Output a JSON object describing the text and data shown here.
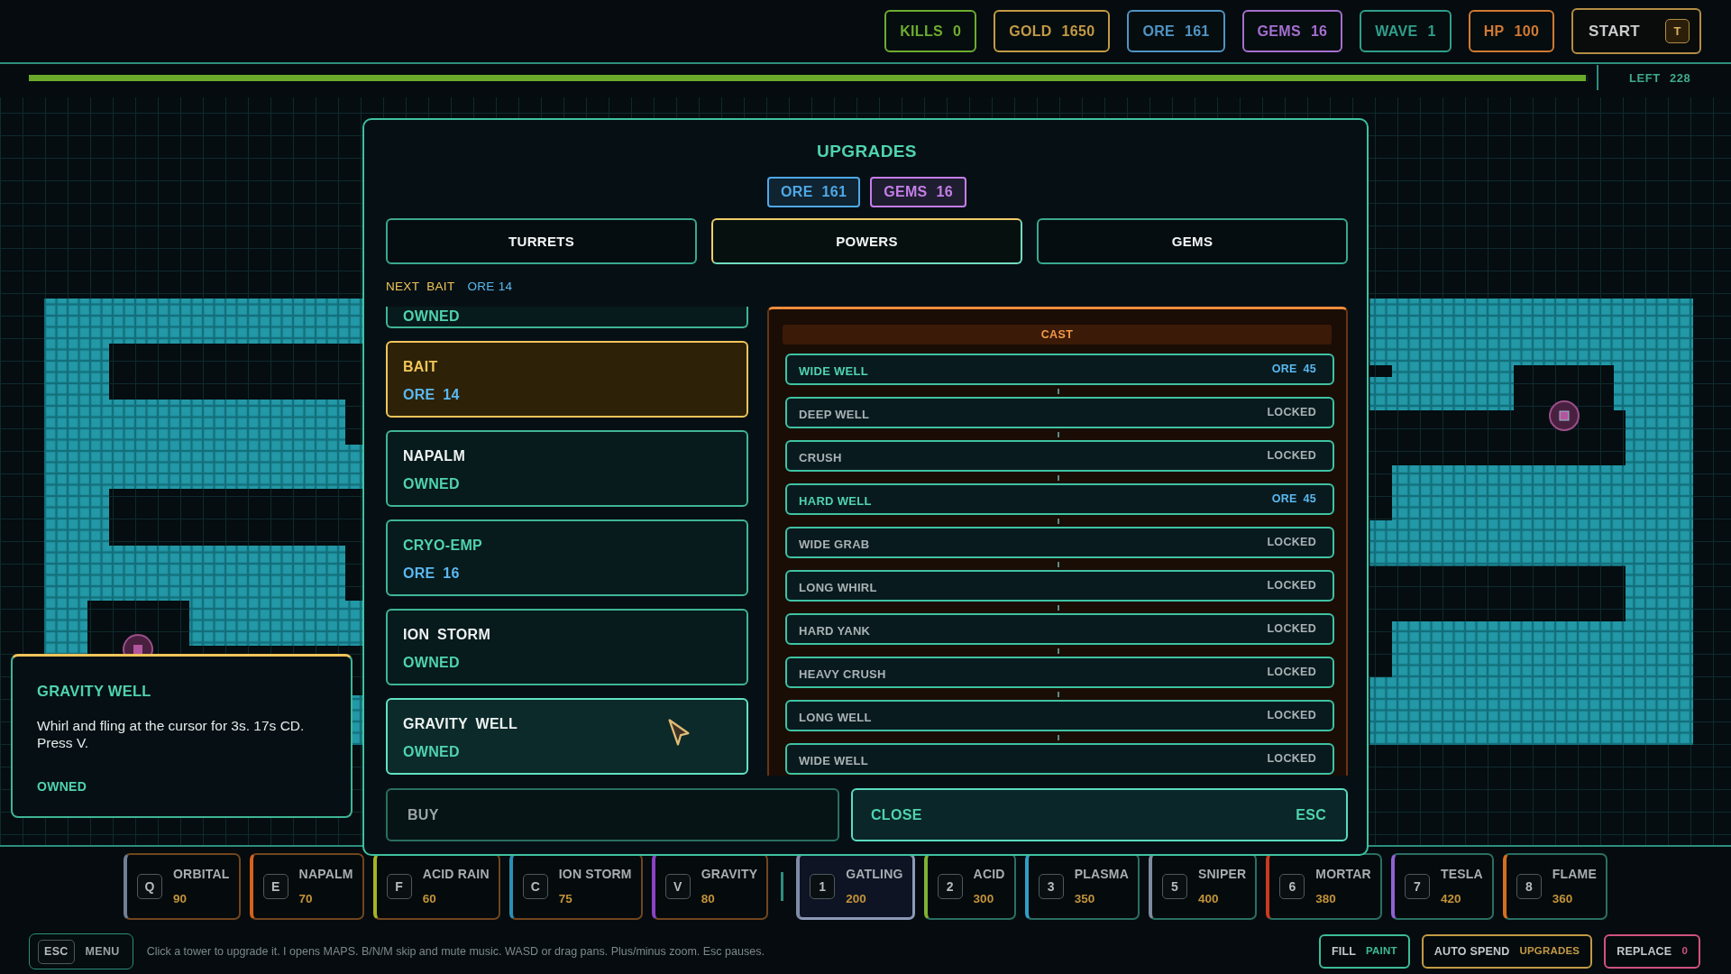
{
  "stats": [
    {
      "label": "KILLS",
      "value": "0",
      "color": "#6cad2f"
    },
    {
      "label": "GOLD",
      "value": "1650",
      "color": "#c39a45"
    },
    {
      "label": "ORE",
      "value": "161",
      "color": "#4f94c4"
    },
    {
      "label": "GEMS",
      "value": "16",
      "color": "#a46fd0"
    },
    {
      "label": "WAVE",
      "value": "1",
      "color": "#2f9f8c"
    },
    {
      "label": "HP",
      "value": "100",
      "color": "#d07a34"
    }
  ],
  "start_button": {
    "label": "START",
    "key": "T"
  },
  "wave_progress": {
    "level": 0.998,
    "label": "LEFT",
    "value": "228"
  },
  "upgrades": {
    "title": "UPGRADES",
    "currencies": [
      {
        "label": "ORE",
        "value": "161",
        "color": "#4fa8e6"
      },
      {
        "label": "GEMS",
        "value": "16",
        "color": "#c47ee8"
      }
    ],
    "tabs": [
      {
        "label": "TURRETS",
        "selected": false
      },
      {
        "label": "POWERS",
        "selected": true
      },
      {
        "label": "GEMS",
        "selected": false
      }
    ],
    "next": {
      "label": "NEXT",
      "item": "BAIT",
      "cost": "ORE 14"
    },
    "powers": [
      {
        "status": "OWNED",
        "owned": true,
        "selected": false,
        "hovered": false
      },
      {
        "name": "BAIT",
        "status": "ORE 14",
        "owned": false,
        "selected": true,
        "hovered": false
      },
      {
        "name": "NAPALM",
        "status": "OWNED",
        "owned": true,
        "selected": false,
        "hovered": false
      },
      {
        "name": "CRYO-EMP",
        "status": "ORE 16",
        "owned": false,
        "selected": false,
        "hovered": false
      },
      {
        "name": "ION STORM",
        "status": "OWNED",
        "owned": true,
        "selected": false,
        "hovered": false
      },
      {
        "name": "GRAVITY WELL",
        "status": "OWNED",
        "owned": true,
        "selected": false,
        "hovered": true
      }
    ],
    "cast": {
      "title": "CAST",
      "rows": [
        {
          "name": "WIDE WELL",
          "tag": "ORE 45",
          "locked": false
        },
        {
          "name": "DEEP WELL",
          "tag": "LOCKED",
          "locked": true
        },
        {
          "name": "CRUSH",
          "tag": "LOCKED",
          "locked": true
        },
        {
          "name": "HARD WELL",
          "tag": "ORE 45",
          "locked": false
        },
        {
          "name": "WIDE GRAB",
          "tag": "LOCKED",
          "locked": true
        },
        {
          "name": "LONG WHIRL",
          "tag": "LOCKED",
          "locked": true
        },
        {
          "name": "HARD YANK",
          "tag": "LOCKED",
          "locked": true
        },
        {
          "name": "HEAVY CRUSH",
          "tag": "LOCKED",
          "locked": true
        },
        {
          "name": "LONG WELL",
          "tag": "LOCKED",
          "locked": true
        },
        {
          "name": "WIDE WELL",
          "tag": "LOCKED",
          "locked": true
        }
      ]
    },
    "buy_button": {
      "label": "BUY",
      "disabled": true
    },
    "close_button": {
      "label": "CLOSE",
      "key": "ESC"
    }
  },
  "tooltip": {
    "title": "GRAVITY WELL",
    "description": "Whirl and fling at the cursor for 3s. 17s CD. Press V.",
    "status": "OWNED"
  },
  "hotbar": {
    "powers": [
      {
        "key": "Q",
        "name": "ORBITAL",
        "cost": "90",
        "color": "#6f7f96",
        "selected": false
      },
      {
        "key": "E",
        "name": "NAPALM",
        "cost": "70",
        "color": "#d5621c",
        "selected": false
      },
      {
        "key": "F",
        "name": "ACID RAIN",
        "cost": "60",
        "color": "#a5b423",
        "selected": false
      },
      {
        "key": "C",
        "name": "ION STORM",
        "cost": "75",
        "color": "#2b8fb5",
        "selected": false
      },
      {
        "key": "V",
        "name": "GRAVITY",
        "cost": "80",
        "color": "#8a43c4",
        "selected": false
      }
    ],
    "turrets": [
      {
        "key": "1",
        "name": "GATLING",
        "cost": "200",
        "color": "#7f8ca8",
        "selected": true
      },
      {
        "key": "2",
        "name": "ACID",
        "cost": "300",
        "color": "#7fb233",
        "selected": false
      },
      {
        "key": "3",
        "name": "PLASMA",
        "cost": "350",
        "color": "#2f9fc5",
        "selected": false
      },
      {
        "key": "5",
        "name": "SNIPER",
        "cost": "400",
        "color": "#7d8ba0",
        "selected": false
      },
      {
        "key": "6",
        "name": "MORTAR",
        "cost": "380",
        "color": "#c93a1e",
        "selected": false
      },
      {
        "key": "7",
        "name": "TESLA",
        "cost": "420",
        "color": "#8f62d6",
        "selected": false
      },
      {
        "key": "8",
        "name": "FLAME",
        "cost": "360",
        "color": "#d56f1f",
        "selected": false
      }
    ]
  },
  "footer": {
    "menu_button": {
      "key": "ESC",
      "label": "MENU"
    },
    "hint": "Click a tower to upgrade it. I opens MAPS. B/N/M skip and mute music. WASD or drag pans. Plus/minus zoom. Esc pauses.",
    "toggles": [
      {
        "label": "FILL",
        "value": "PAINT",
        "color": "#3dbb98"
      },
      {
        "label": "AUTO SPEND",
        "value": "UPGRADES",
        "color": "#c39a45"
      },
      {
        "label": "REPLACE",
        "value": "0",
        "color": "#d0527e"
      }
    ]
  }
}
